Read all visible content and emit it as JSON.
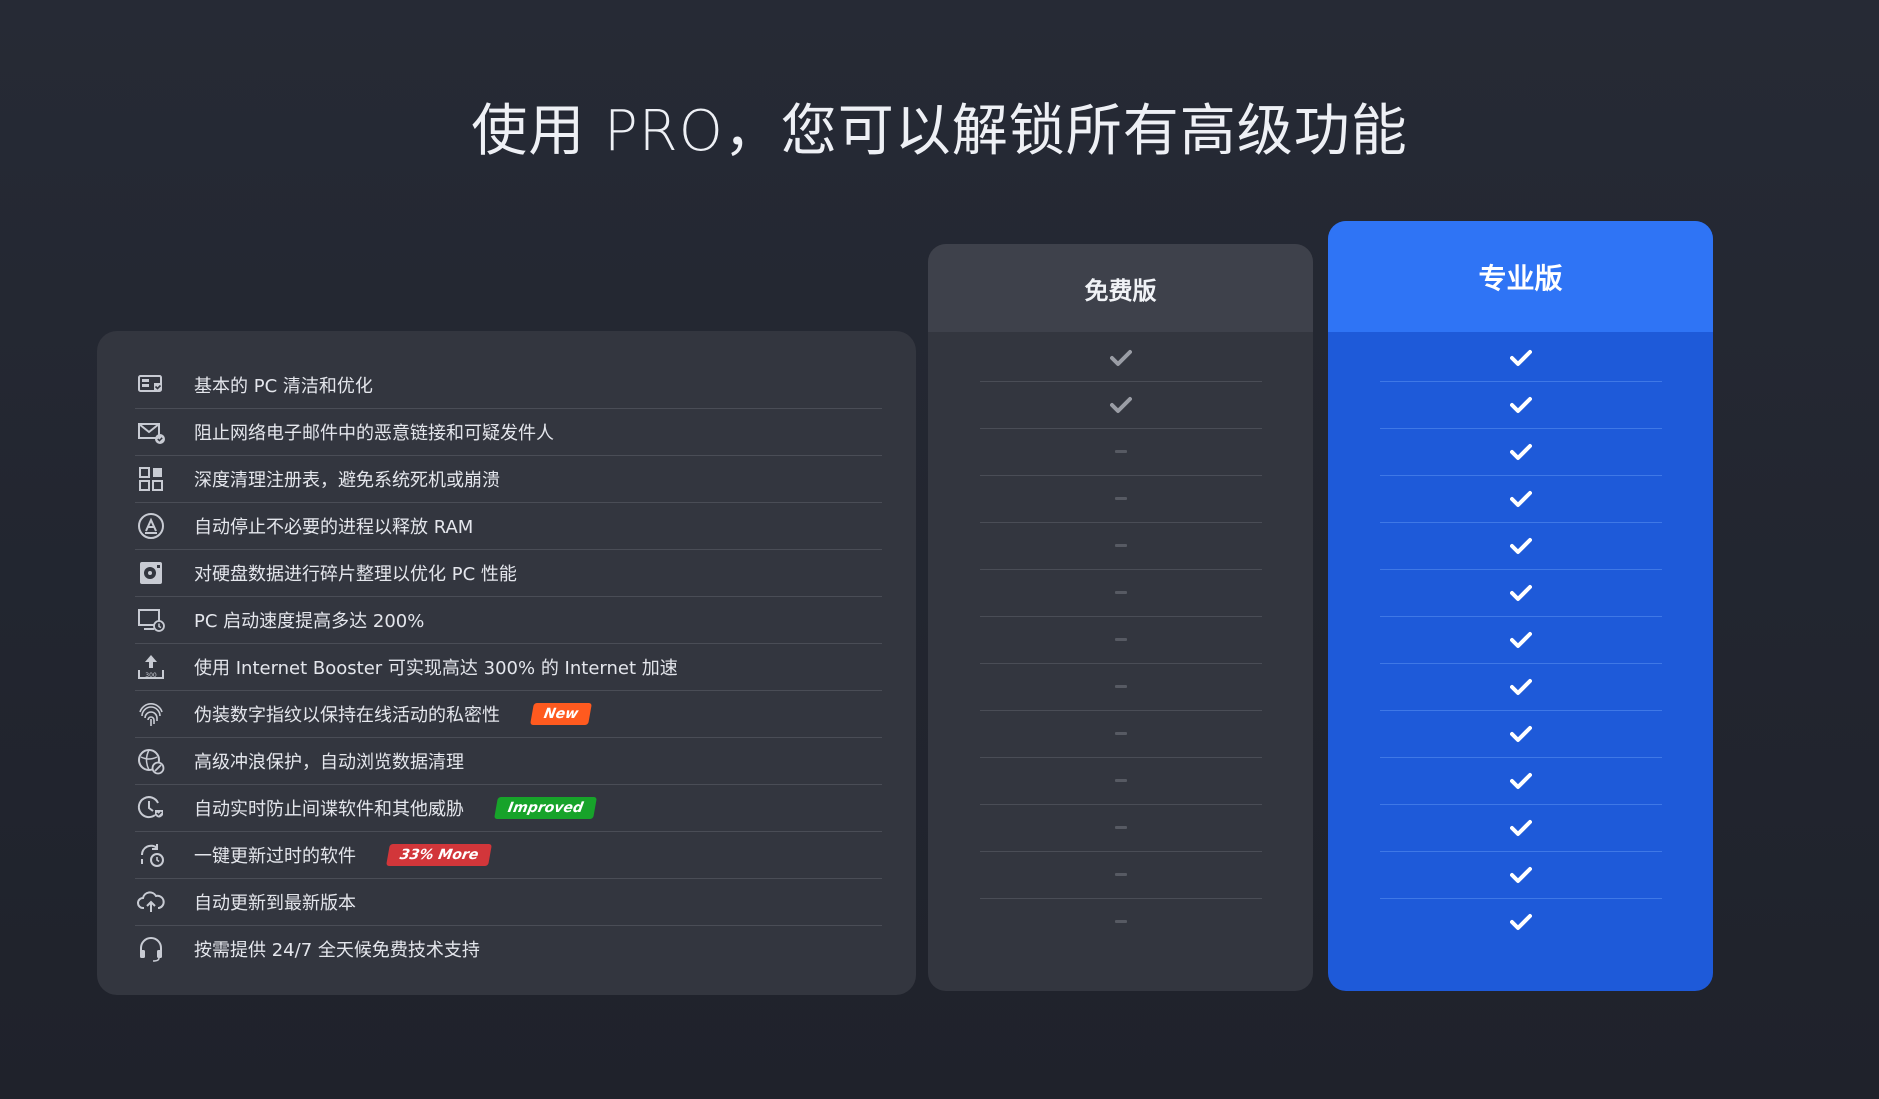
{
  "title": "使用 PRO，您可以解锁所有高级功能",
  "plans": {
    "free": "免费版",
    "pro": "专业版"
  },
  "colors": {
    "background": "#22252e",
    "card": "#33363f",
    "pro_accent": "#2f74f5",
    "pro_body": "#1e5ad9",
    "badge_new": "#ff5a1f",
    "badge_improved": "#17a32a",
    "badge_more": "#d2363a"
  },
  "features": [
    {
      "label": "基本的 PC 清洁和优化",
      "icon": "pc-clean-icon",
      "free": "check",
      "pro": "check"
    },
    {
      "label": "阻止网络电子邮件中的恶意链接和可疑发件人",
      "icon": "mail-shield-icon",
      "free": "check",
      "pro": "check"
    },
    {
      "label": "深度清理注册表，避免系统死机或崩溃",
      "icon": "registry-grid-icon",
      "free": "none",
      "pro": "check"
    },
    {
      "label": "自动停止不必要的进程以释放 RAM",
      "icon": "ram-release-icon",
      "free": "none",
      "pro": "check"
    },
    {
      "label": "对硬盘数据进行碎片整理以优化 PC 性能",
      "icon": "disk-defrag-icon",
      "free": "none",
      "pro": "check"
    },
    {
      "label": "PC 启动速度提高多达 200%",
      "icon": "startup-speed-icon",
      "free": "none",
      "pro": "check"
    },
    {
      "label": "使用 Internet Booster 可实现高达 300% 的 Internet 加速",
      "icon": "internet-boost-icon",
      "free": "none",
      "pro": "check"
    },
    {
      "label": "伪装数字指纹以保持在线活动的私密性",
      "icon": "fingerprint-icon",
      "free": "none",
      "pro": "check",
      "badge": "New",
      "badge_color": "#ff5a1f"
    },
    {
      "label": "高级冲浪保护，自动浏览数据清理",
      "icon": "surf-protect-icon",
      "free": "none",
      "pro": "check"
    },
    {
      "label": "自动实时防止间谍软件和其他威胁",
      "icon": "realtime-shield-icon",
      "free": "none",
      "pro": "check",
      "badge": "Improved",
      "badge_color": "#17a32a"
    },
    {
      "label": "一键更新过时的软件",
      "icon": "software-update-icon",
      "free": "none",
      "pro": "check",
      "badge": "33% More",
      "badge_color": "#d2363a"
    },
    {
      "label": "自动更新到最新版本",
      "icon": "cloud-update-icon",
      "free": "none",
      "pro": "check"
    },
    {
      "label": "按需提供 24/7 全天候免费技术支持",
      "icon": "headset-support-icon",
      "free": "none",
      "pro": "check"
    }
  ]
}
